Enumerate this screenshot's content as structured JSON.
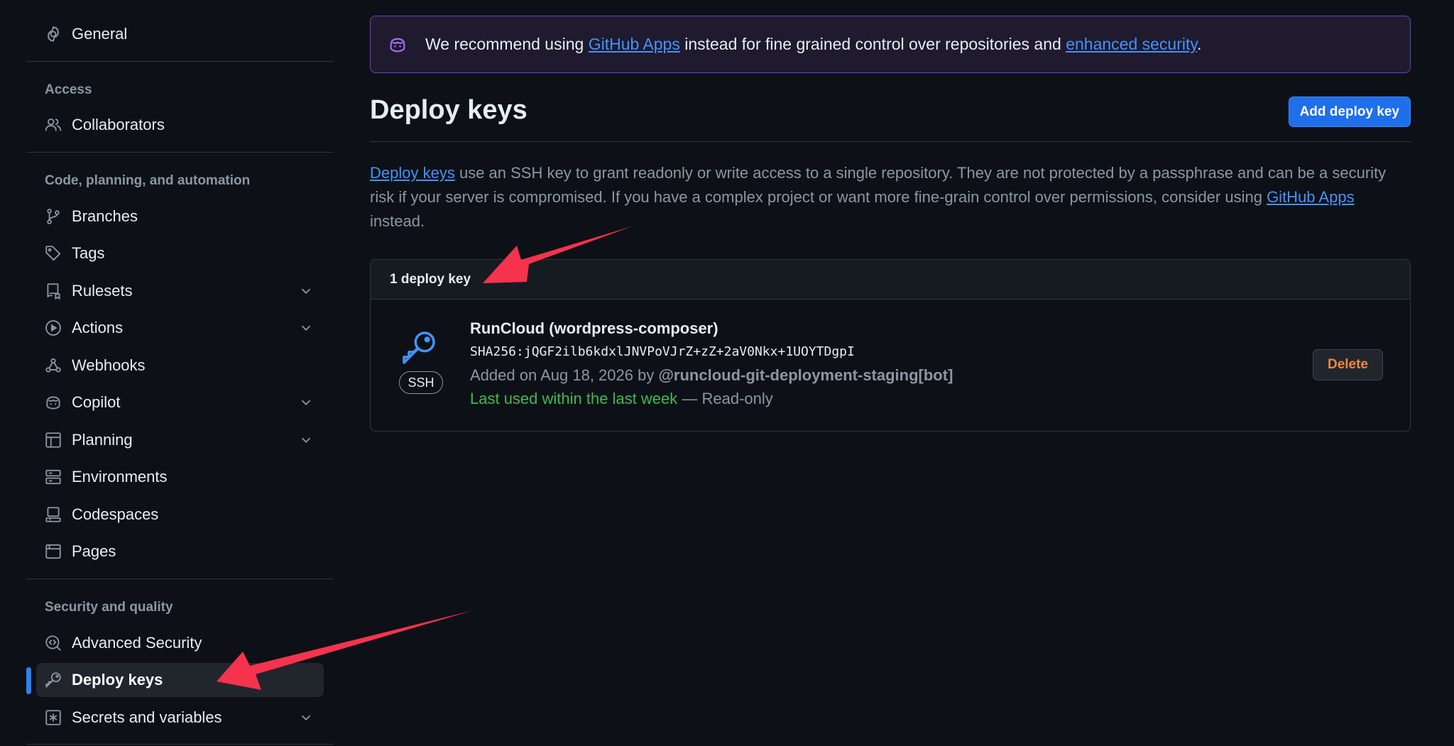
{
  "sidebar": {
    "general": "General",
    "sections": {
      "access": "Access",
      "code": "Code, planning, and automation",
      "security": "Security and quality"
    },
    "items": {
      "collaborators": "Collaborators",
      "branches": "Branches",
      "tags": "Tags",
      "rulesets": "Rulesets",
      "actions": "Actions",
      "webhooks": "Webhooks",
      "copilot": "Copilot",
      "planning": "Planning",
      "environments": "Environments",
      "codespaces": "Codespaces",
      "pages": "Pages",
      "advanced_security": "Advanced Security",
      "deploy_keys": "Deploy keys",
      "secrets": "Secrets and variables"
    },
    "active_item": "deploy_keys"
  },
  "banner": {
    "pre": "We recommend using ",
    "link1": "GitHub Apps",
    "mid": " instead for fine grained control over repositories and ",
    "link2": "enhanced security",
    "post": "."
  },
  "page": {
    "title": "Deploy keys",
    "add_button": "Add deploy key",
    "desc_link1": "Deploy keys",
    "desc_text": " use an SSH key to grant readonly or write access to a single repository. They are not protected by a passphrase and can be a security risk if your server is compromised. If you have a complex project or want more fine-grain control over permissions, consider using ",
    "desc_link2": "GitHub Apps",
    "desc_end": " instead."
  },
  "keys": {
    "count_label": "1 deploy key",
    "items": [
      {
        "title": "RunCloud (wordpress-composer)",
        "fingerprint": "SHA256:jQGF2ilb6kdxlJNVPoVJrZ+zZ+2aV0Nkx+1UOYTDgpI",
        "added_prefix": "Added on Aug 18, 2026 by ",
        "added_by": "@runcloud-git-deployment-staging[bot]",
        "last_used": "Last used within the last week",
        "access": " — Read-only",
        "badge": "SSH",
        "delete_label": "Delete"
      }
    ]
  },
  "colors": {
    "background": "#0d1117",
    "accent": "#2f81f7",
    "link": "#4493f8",
    "success": "#3fb950",
    "danger_text": "#f0883e",
    "annotation": "#f5334d"
  }
}
